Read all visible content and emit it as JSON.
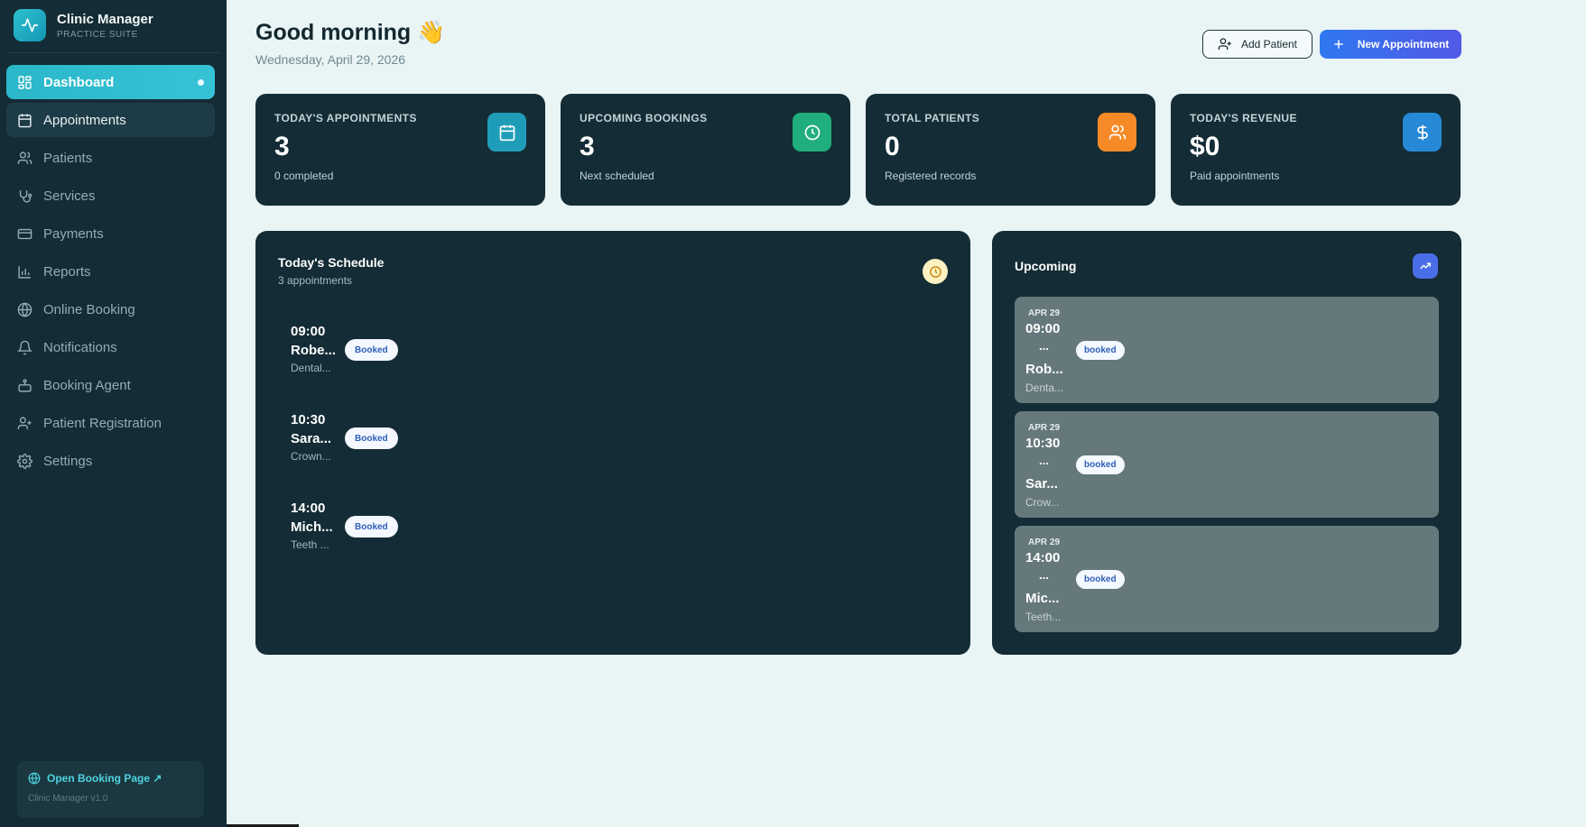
{
  "brand": {
    "name": "Clinic Manager",
    "subtitle": "PRACTICE SUITE"
  },
  "nav": [
    {
      "label": "Dashboard",
      "icon": "dashboard-icon",
      "state": "active"
    },
    {
      "label": "Appointments",
      "icon": "calendar-icon",
      "state": "hover"
    },
    {
      "label": "Patients",
      "icon": "users-icon",
      "state": ""
    },
    {
      "label": "Services",
      "icon": "stethoscope-icon",
      "state": ""
    },
    {
      "label": "Payments",
      "icon": "credit-card-icon",
      "state": ""
    },
    {
      "label": "Reports",
      "icon": "bar-chart-icon",
      "state": ""
    },
    {
      "label": "Online Booking",
      "icon": "globe-icon",
      "state": ""
    },
    {
      "label": "Notifications",
      "icon": "bell-icon",
      "state": ""
    },
    {
      "label": "Booking Agent",
      "icon": "bot-icon",
      "state": ""
    },
    {
      "label": "Patient Registration",
      "icon": "user-plus-icon",
      "state": ""
    },
    {
      "label": "Settings",
      "icon": "gear-icon",
      "state": ""
    }
  ],
  "footer": {
    "booking_link": "Open Booking Page ↗",
    "version": "Clinic Manager v1.0"
  },
  "header": {
    "greeting": "Good morning 👋",
    "date": "Wednesday, April 29, 2026",
    "add_patient": "Add Patient",
    "new_appointment": "New Appointment"
  },
  "stats": [
    {
      "label": "TODAY'S APPOINTMENTS",
      "value": "3",
      "sub": "0 completed",
      "icon": "calendar-icon",
      "color": "#1f9db8"
    },
    {
      "label": "UPCOMING BOOKINGS",
      "value": "3",
      "sub": "Next scheduled",
      "icon": "clock-icon",
      "color": "#1fae7c"
    },
    {
      "label": "TOTAL PATIENTS",
      "value": "0",
      "sub": "Registered records",
      "icon": "users-icon",
      "color": "#f58a26"
    },
    {
      "label": "TODAY'S REVENUE",
      "value": "$0",
      "sub": "Paid appointments",
      "icon": "dollar-icon",
      "color": "#2589d6"
    }
  ],
  "schedule": {
    "title": "Today's Schedule",
    "subtitle": "3 appointments",
    "items": [
      {
        "time": "09:00",
        "name": "Robe...",
        "service": "Dental...",
        "status": "Booked"
      },
      {
        "time": "10:30",
        "name": "Sara...",
        "service": "Crown...",
        "status": "Booked"
      },
      {
        "time": "14:00",
        "name": "Mich...",
        "service": "Teeth ...",
        "status": "Booked"
      }
    ]
  },
  "upcoming": {
    "title": "Upcoming",
    "items": [
      {
        "date": "APR 29",
        "time": "09:00",
        "ellipsis": "...",
        "name": "Rob...",
        "service": "Denta...",
        "status": "booked"
      },
      {
        "date": "APR 29",
        "time": "10:30",
        "ellipsis": "...",
        "name": "Sar...",
        "service": "Crow...",
        "status": "booked"
      },
      {
        "date": "APR 29",
        "time": "14:00",
        "ellipsis": "...",
        "name": "Mic...",
        "service": "Teeth...",
        "status": "booked"
      }
    ]
  }
}
